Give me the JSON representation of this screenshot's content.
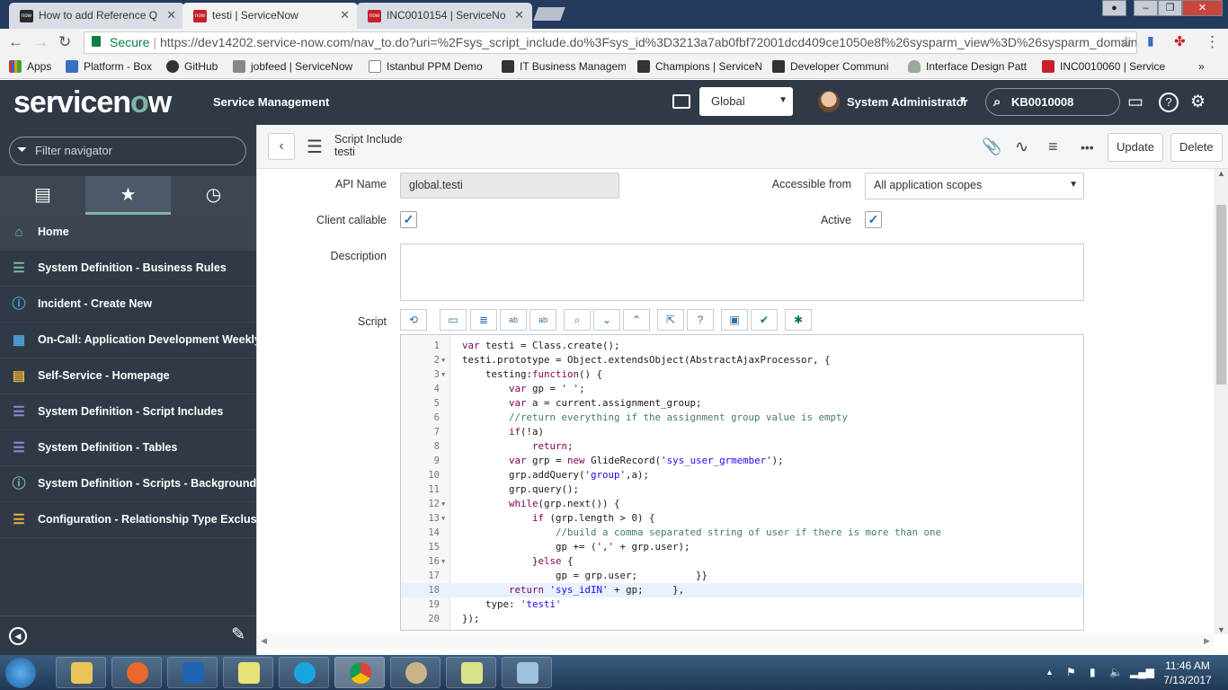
{
  "browser": {
    "tabs": [
      {
        "title": "How to add Reference Q",
        "icon": "servicenow-favicon"
      },
      {
        "title": "testi | ServiceNow",
        "icon": "servicenow-favicon"
      },
      {
        "title": "INC0010154 | ServiceNo",
        "icon": "servicenow-favicon"
      }
    ],
    "secure_label": "Secure",
    "url": "https://dev14202.service-now.com/nav_to.do?uri=%2Fsys_script_include.do%3Fsys_id%3D3213a7ab0fbf72001dcd409ce1050e8f%26sysparm_view%3D%26sysparm_domain%",
    "bookmarks": [
      "Apps",
      "Platform - Box",
      "GitHub",
      "jobfeed | ServiceNow",
      "Istanbul PPM Demo",
      "IT Business Managem",
      "Champions | ServiceN",
      "Developer Communi",
      "Interface Design Patt",
      "INC0010060 | Service"
    ]
  },
  "header": {
    "logo_main": "servicen",
    "logo_o": "o",
    "logo_end": "w",
    "product": "Service Management",
    "scope": "Global",
    "user": "System Administrator",
    "search_value": "KB0010008"
  },
  "nav": {
    "filter_placeholder": "Filter navigator",
    "items": [
      {
        "label": "Home",
        "icon": "home-icon"
      },
      {
        "label": "System Definition - Business Rules",
        "icon": "list-icon"
      },
      {
        "label": "Incident - Create New",
        "icon": "info-icon"
      },
      {
        "label": "On-Call: Application Development Weekly",
        "icon": "calendar-icon"
      },
      {
        "label": "Self-Service - Homepage",
        "icon": "document-icon"
      },
      {
        "label": "System Definition - Script Includes",
        "icon": "list-icon"
      },
      {
        "label": "System Definition - Tables",
        "icon": "list-icon"
      },
      {
        "label": "System Definition - Scripts - Background",
        "icon": "info-icon"
      },
      {
        "label": "Configuration - Relationship Type Exclus...",
        "icon": "list-icon"
      }
    ]
  },
  "form": {
    "table": "Script Include",
    "record": "testi",
    "update_label": "Update",
    "delete_label": "Delete",
    "api_name_label": "API Name",
    "api_name_value": "global.testi",
    "accessible_label": "Accessible from",
    "accessible_value": "All application scopes",
    "client_callable_label": "Client callable",
    "client_callable": true,
    "active_label": "Active",
    "active": true,
    "description_label": "Description",
    "description_value": "",
    "script_label": "Script",
    "script_lines": [
      "var testi = Class.create();",
      "testi.prototype = Object.extendsObject(AbstractAjaxProcessor, {",
      "    testing:function() {",
      "        var gp = ' ';",
      "        var a = current.assignment_group;",
      "        //return everything if the assignment group value is empty",
      "        if(!a)",
      "            return;",
      "        var grp = new GlideRecord('sys_user_grmember');",
      "        grp.addQuery('group',a);",
      "        grp.query();",
      "        while(grp.next()) {",
      "            if (grp.length > 0) {",
      "                //build a comma separated string of user if there is more than one",
      "                gp += (',' + grp.user);",
      "            }else {",
      "                gp = grp.user;          }}",
      "        return 'sys_idIN' + gp;     },",
      "    type: 'testi'",
      "});"
    ],
    "folded_lines": [
      2,
      3,
      12,
      13,
      16
    ]
  },
  "taskbar": {
    "time": "11:46 AM",
    "date": "7/13/2017"
  }
}
